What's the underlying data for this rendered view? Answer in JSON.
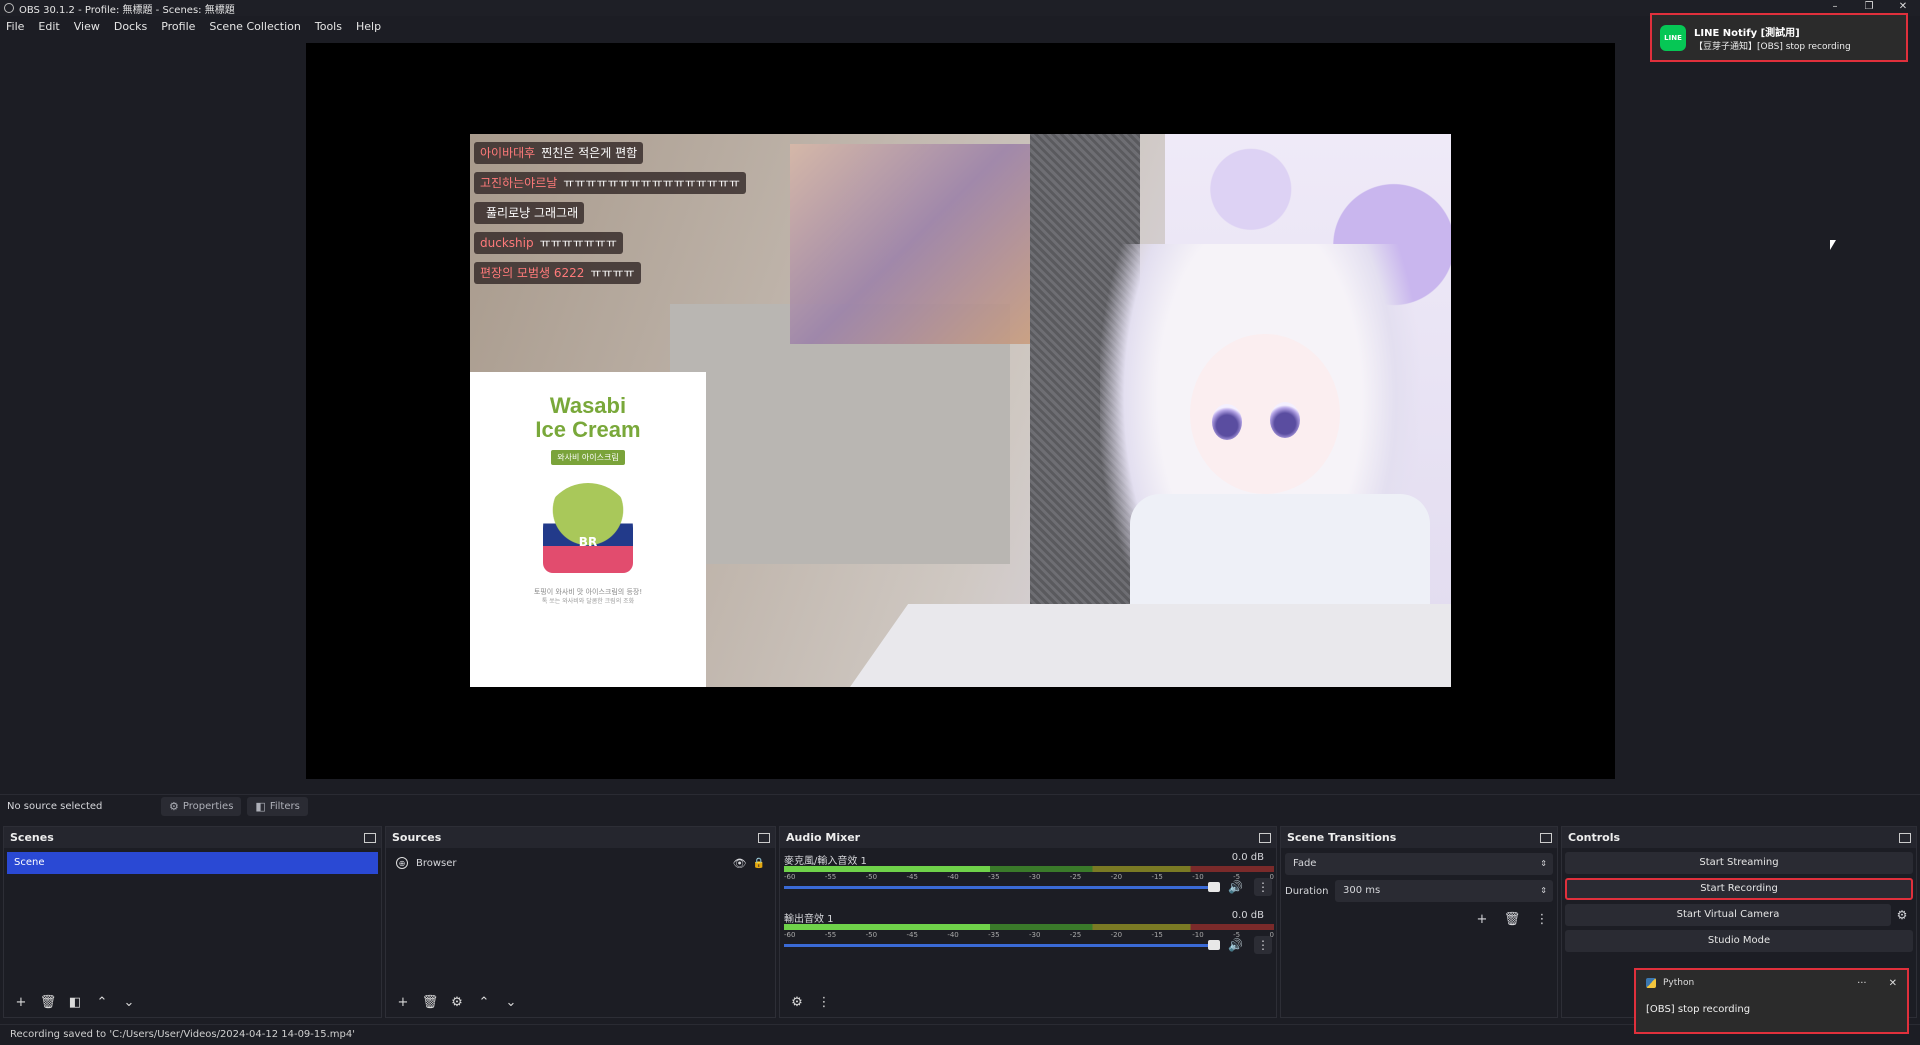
{
  "window": {
    "title": "OBS 30.1.2 - Profile: 無標題 - Scenes: 無標題",
    "controls": [
      "–",
      "❐",
      "✕"
    ]
  },
  "menu": [
    "File",
    "Edit",
    "View",
    "Docks",
    "Profile",
    "Scene Collection",
    "Tools",
    "Help"
  ],
  "preview": {
    "chat": [
      {
        "user": "아이바대후",
        "msg": "찐친은 적은게 편함"
      },
      {
        "user": "고진하는야르날",
        "msg": "ㅠㅠㅠㅠㅠㅠㅠㅠㅠㅠㅠㅠㅠㅠㅠㅠ"
      },
      {
        "user": "",
        "msg": "풀리로냥 그래그래"
      },
      {
        "user": "duckship",
        "msg": "ㅠㅠㅠㅠㅠㅠㅠ"
      },
      {
        "user": "편장의 모범생 6222",
        "msg": "ㅠㅠㅠㅠ"
      }
    ],
    "ad": {
      "title_line1": "Wasabi",
      "title_line2": "Ice Cream",
      "badge": "와사비 아이스크림",
      "cup_logo": "BR",
      "fine1": "토핑이 와사비 맛 아이스크림의 등장!",
      "fine2": "톡 쏘는 와사비와 달콤한 크림의 조화"
    }
  },
  "status_row": {
    "no_source": "No source selected",
    "properties": "Properties",
    "filters": "Filters"
  },
  "scenes": {
    "title": "Scenes",
    "items": [
      "Scene"
    ]
  },
  "sources": {
    "title": "Sources",
    "items": [
      {
        "name": "Browser"
      }
    ]
  },
  "audio_mixer": {
    "title": "Audio Mixer",
    "channels": [
      {
        "name": "麥克風/輸入音效 1",
        "db": "0.0 dB",
        "level": 0.42
      },
      {
        "name": "輸出音效 1",
        "db": "0.0 dB",
        "level": 0.42
      }
    ],
    "ticks": [
      "-60",
      "-55",
      "-50",
      "-45",
      "-40",
      "-35",
      "-30",
      "-25",
      "-20",
      "-15",
      "-10",
      "-5",
      "0"
    ]
  },
  "transitions": {
    "title": "Scene Transitions",
    "selected": "Fade",
    "duration_label": "Duration",
    "duration_value": "300 ms"
  },
  "controls": {
    "title": "Controls",
    "start_streaming": "Start Streaming",
    "start_recording": "Start Recording",
    "start_virtual_camera": "Start Virtual Camera",
    "studio_mode": "Studio Mode"
  },
  "bottom_status": "Recording saved to 'C:/Users/User/Videos/2024-04-12 14-09-15.mp4'",
  "notifications": {
    "line": {
      "logo": "LINE",
      "title": "LINE Notify [測試用]",
      "message": "【豆芽子通知】[OBS] stop recording"
    },
    "python": {
      "app": "Python",
      "message": "[OBS] stop recording"
    }
  },
  "colors": {
    "accent": "#2a49d4",
    "highlight_border": "#e0303c",
    "line_green": "#06c755"
  }
}
